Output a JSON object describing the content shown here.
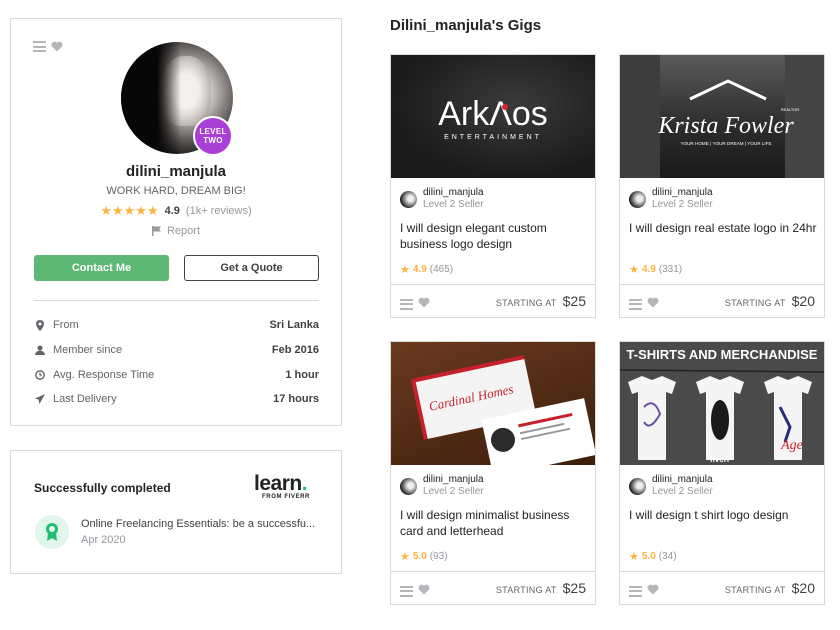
{
  "profile": {
    "username": "dilini_manjula",
    "tagline": "WORK HARD, DREAM BIG!",
    "level_badge": [
      "LEVEL",
      "TWO"
    ],
    "stars": "★★★★★",
    "rating": "4.9",
    "reviews": "(1k+ reviews)",
    "report_label": "Report",
    "contact_label": "Contact Me",
    "quote_label": "Get a Quote",
    "info": [
      {
        "icon": "location-pin-icon",
        "label": "From",
        "value": "Sri Lanka"
      },
      {
        "icon": "user-icon",
        "label": "Member since",
        "value": "Feb 2016"
      },
      {
        "icon": "clock-icon",
        "label": "Avg. Response Time",
        "value": "1 hour"
      },
      {
        "icon": "paper-plane-icon",
        "label": "Last Delivery",
        "value": "17 hours"
      }
    ]
  },
  "learn": {
    "title": "Successfully completed",
    "logo_text": "learn",
    "logo_dot": ".",
    "logo_sub": "FROM FIVERR",
    "course_title": "Online Freelancing Essentials: be a successfu...",
    "course_date": "Apr 2020"
  },
  "gigs_title": "Dilini_manjula's Gigs",
  "gigs": [
    {
      "seller": "dilini_manjula",
      "level": "Level 2 Seller",
      "description": "I will design elegant custom business logo design",
      "rating": "4.9",
      "count": "(465)",
      "starting_at": "STARTING AT",
      "price": "$25",
      "image_text": {
        "main": "ArkΛos",
        "sub": "ENTERTAINMENT"
      }
    },
    {
      "seller": "dilini_manjula",
      "level": "Level 2 Seller",
      "description": "I will design real estate logo in 24hr",
      "rating": "4.9",
      "count": "(331)",
      "starting_at": "STARTING AT",
      "price": "$20",
      "image_text": {
        "main": "Krista Fowler",
        "sup": "REALTOR",
        "sub": "YOUR HOME | YOUR DREAM | YOUR LIFE"
      }
    },
    {
      "seller": "dilini_manjula",
      "level": "Level 2 Seller",
      "description": "I will design minimalist business card and letterhead",
      "rating": "5.0",
      "count": "(93)",
      "starting_at": "STARTING AT",
      "price": "$25",
      "image_text": {
        "main": "Cardinal Homes"
      }
    },
    {
      "seller": "dilini_manjula",
      "level": "Level 2 Seller",
      "description": "I will design t shirt logo design",
      "rating": "5.0",
      "count": "(34)",
      "starting_at": "STARTING AT",
      "price": "$20",
      "image_text": {
        "main": "T-SHIRTS AND MERCHANDISE",
        "watermark": "fiverr",
        "shirt_word": "Age"
      }
    }
  ],
  "colors": {
    "green": "#5cb872",
    "level_purple": "#a93fd6",
    "star": "#ffb33e"
  }
}
